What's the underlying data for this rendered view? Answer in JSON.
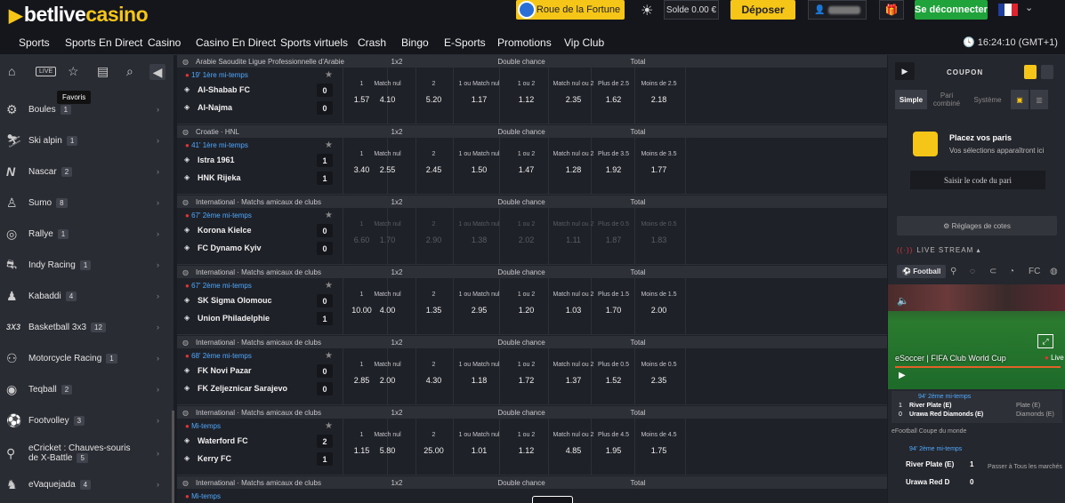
{
  "brand": {
    "part1": "betlive",
    "part2": "casino"
  },
  "header": {
    "fortune_label": "Roue de la Fortune",
    "solde_label": "Solde",
    "solde_value": "0.00 €",
    "deposit_label": "Déposer",
    "logout_label": "Se déconnecter",
    "colors": {
      "accent": "#f5c518",
      "logout": "#20a33a"
    }
  },
  "nav": {
    "items": [
      "Sports",
      "Sports En Direct",
      "Casino",
      "Casino En Direct",
      "Sports virtuels",
      "Crash",
      "Bingo",
      "E-Sports",
      "Promotions",
      "Vip Club"
    ],
    "clock": "16:24:10",
    "timezone": "(GMT+1)"
  },
  "sidebar": {
    "tooltip": "Favoris",
    "live_label": "LIVE",
    "sports": [
      {
        "name": "Boules",
        "count": "1",
        "icon": "boules-icon"
      },
      {
        "name": "Ski alpin",
        "count": "1",
        "icon": "ski-icon"
      },
      {
        "name": "Nascar",
        "count": "2",
        "icon": "nascar-icon"
      },
      {
        "name": "Sumo",
        "count": "8",
        "icon": "sumo-icon"
      },
      {
        "name": "Rallye",
        "count": "1",
        "icon": "rally-icon"
      },
      {
        "name": "Indy Racing",
        "count": "1",
        "icon": "indy-icon"
      },
      {
        "name": "Kabaddi",
        "count": "4",
        "icon": "kabaddi-icon"
      },
      {
        "name": "Basketball 3x3",
        "count": "12",
        "icon": "basketball-icon"
      },
      {
        "name": "Motorcycle Racing",
        "count": "1",
        "icon": "motorcycle-icon"
      },
      {
        "name": "Teqball",
        "count": "2",
        "icon": "teqball-icon"
      },
      {
        "name": "Footvolley",
        "count": "3",
        "icon": "footvolley-icon"
      },
      {
        "name": "eCricket : Chauves-souris de X-Battle",
        "count": "5",
        "icon": "cricket-icon"
      },
      {
        "name": "eVaquejada",
        "count": "4",
        "icon": "vaquejada-icon"
      }
    ]
  },
  "market_headers": {
    "m1": "1x2",
    "m2": "Double chance",
    "m3": "Total"
  },
  "matches": [
    {
      "league": "Arabie Saoudite Ligue Professionnelle d'Arabie",
      "time": "19' 1ère mi-temps",
      "home": "Al-Shabab FC",
      "away": "Al-Najma",
      "score_home": "0",
      "score_away": "0",
      "labels": [
        "1",
        "Match nul",
        "2",
        "1 ou Match nul",
        "1 ou 2",
        "Match nul ou 2",
        "Plus de 2.5",
        "Moins de 2.5"
      ],
      "odds": [
        "1.57",
        "4.10",
        "5.20",
        "1.17",
        "1.12",
        "2.35",
        "1.62",
        "2.18"
      ],
      "dim": false
    },
    {
      "league": "Croatie · HNL",
      "time": "41' 1ère mi-temps",
      "home": "Istra 1961",
      "away": "HNK Rijeka",
      "score_home": "1",
      "score_away": "1",
      "labels": [
        "1",
        "Match nul",
        "2",
        "1 ou Match nul",
        "1 ou 2",
        "Match nul ou 2",
        "Plus de 3.5",
        "Moins de 3.5"
      ],
      "odds": [
        "3.40",
        "2.55",
        "2.45",
        "1.50",
        "1.47",
        "1.28",
        "1.92",
        "1.77"
      ],
      "dim": false
    },
    {
      "league": "International · Matchs amicaux de clubs",
      "time": "67' 2ème mi-temps",
      "home": "Korona Kielce",
      "away": "FC Dynamo Kyiv",
      "score_home": "0",
      "score_away": "0",
      "labels": [
        "1",
        "Match nul",
        "2",
        "1 ou Match nul",
        "1 ou 2",
        "Match nul ou 2",
        "Plus de 0.5",
        "Moins de 0.5"
      ],
      "odds": [
        "6.60",
        "1.70",
        "2.90",
        "1.38",
        "2.02",
        "1.11",
        "1.87",
        "1.83"
      ],
      "dim": true
    },
    {
      "league": "International · Matchs amicaux de clubs",
      "time": "67' 2ème mi-temps",
      "home": "SK Sigma Olomouc",
      "away": "Union Philadelphie",
      "score_home": "0",
      "score_away": "1",
      "labels": [
        "1",
        "Match nul",
        "2",
        "1 ou Match nul",
        "1 ou 2",
        "Match nul ou 2",
        "Plus de 1.5",
        "Moins de 1.5"
      ],
      "odds": [
        "10.00",
        "4.00",
        "1.35",
        "2.95",
        "1.20",
        "1.03",
        "1.70",
        "2.00"
      ],
      "dim": false
    },
    {
      "league": "International · Matchs amicaux de clubs",
      "time": "68' 2ème mi-temps",
      "home": "FK Novi Pazar",
      "away": "FK Zeljeznicar Sarajevo",
      "score_home": "0",
      "score_away": "0",
      "labels": [
        "1",
        "Match nul",
        "2",
        "1 ou Match nul",
        "1 ou 2",
        "Match nul ou 2",
        "Plus de 0.5",
        "Moins de 0.5"
      ],
      "odds": [
        "2.85",
        "2.00",
        "4.30",
        "1.18",
        "1.72",
        "1.37",
        "1.52",
        "2.35"
      ],
      "dim": false
    },
    {
      "league": "International · Matchs amicaux de clubs",
      "time": "Mi-temps",
      "home": "Waterford FC",
      "away": "Kerry FC",
      "score_home": "2",
      "score_away": "1",
      "labels": [
        "1",
        "Match nul",
        "2",
        "1 ou Match nul",
        "1 ou 2",
        "Match nul ou 2",
        "Plus de 4.5",
        "Moins de 4.5"
      ],
      "odds": [
        "1.15",
        "5.80",
        "25.00",
        "1.01",
        "1.12",
        "4.85",
        "1.95",
        "1.75"
      ],
      "dim": false
    }
  ],
  "last_league": "International · Matchs amicaux de clubs",
  "last_time": "Mi-temps",
  "coupon": {
    "title": "COUPON",
    "tabs": [
      "Simple",
      "Pari combiné",
      "Système"
    ],
    "place_title": "Placez vos paris",
    "place_sub": "Vos sélections apparaîtront ici",
    "code_button": "Saisir le code du pari",
    "odds_settings": "Réglages de cotes",
    "live_stream": "LIVE STREAM",
    "football_tab": "Football"
  },
  "stream": {
    "title": "eSoccer | FIFA Club World Cup",
    "live": "Live",
    "mini_time": "94' 2ème mi-temps",
    "mini_home": "River Plate (E)",
    "mini_away": "Urawa Red Diamonds (E)",
    "mini_score_home": "1",
    "mini_score_away": "0",
    "mini_right_home": "Plate (E)",
    "mini_right_away": "Diamonds (E)",
    "efootball": "eFootball Coupe du monde",
    "m2_time": "94' 2ème mi-temps",
    "m2_home": "River Plate (E)",
    "m2_away": "Urawa Red D",
    "m2_score_home": "1",
    "m2_score_away": "0",
    "passer": "Passer à Tous les marchés"
  }
}
